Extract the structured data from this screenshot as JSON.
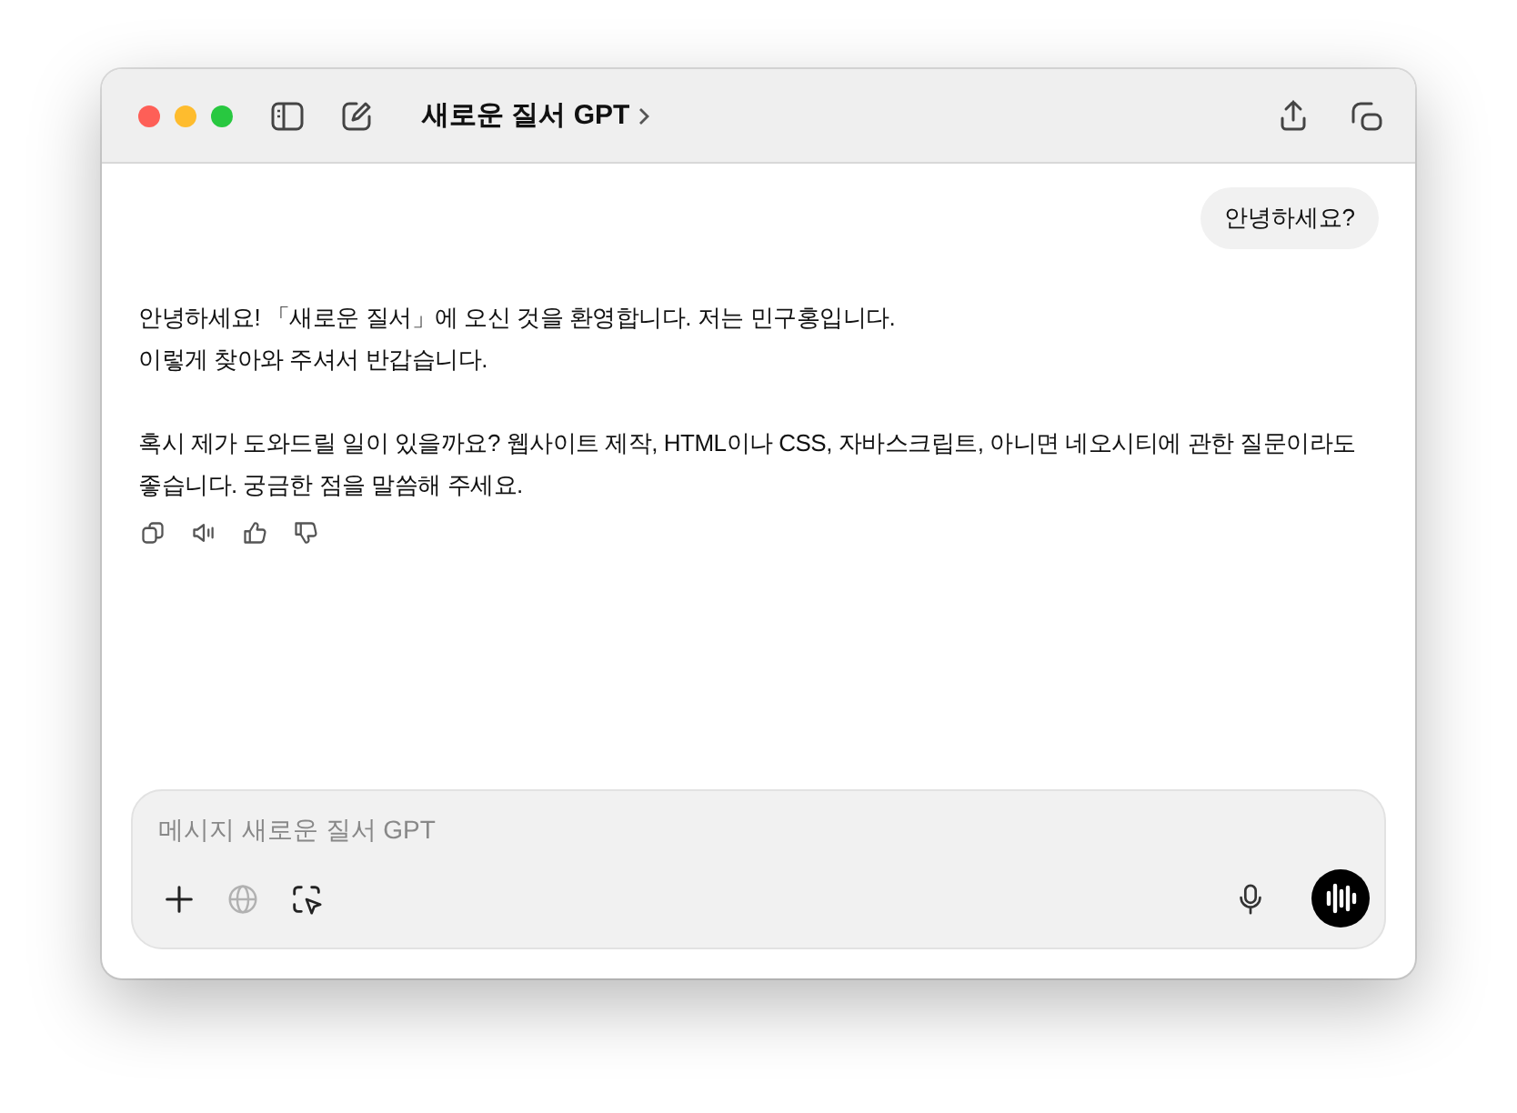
{
  "window": {
    "title": "새로운 질서 GPT"
  },
  "messages": [
    {
      "kind": "user",
      "text": "안녕하세요?"
    },
    {
      "kind": "assistant",
      "paragraphs": [
        [
          "안녕하세요! 「새로운 질서」에 오신 것을 환영합니다. 저는 민구홍입니다.",
          "이렇게 찾아와 주셔서 반갑습니다."
        ],
        [
          "혹시 제가 도와드릴 일이 있을까요? 웹사이트 제작, HTML이나 CSS, 자바스크립트, 아니면 네오시티에 관한 질문이라도 좋습니다. 궁금한 점을 말씀해 주세요."
        ]
      ]
    }
  ],
  "composer": {
    "placeholder": "메시지 새로운 질서 GPT",
    "tools": [
      {
        "kind": "plus",
        "disabled": false
      },
      {
        "kind": "globe",
        "disabled": true
      },
      {
        "kind": "select",
        "disabled": false
      }
    ]
  }
}
